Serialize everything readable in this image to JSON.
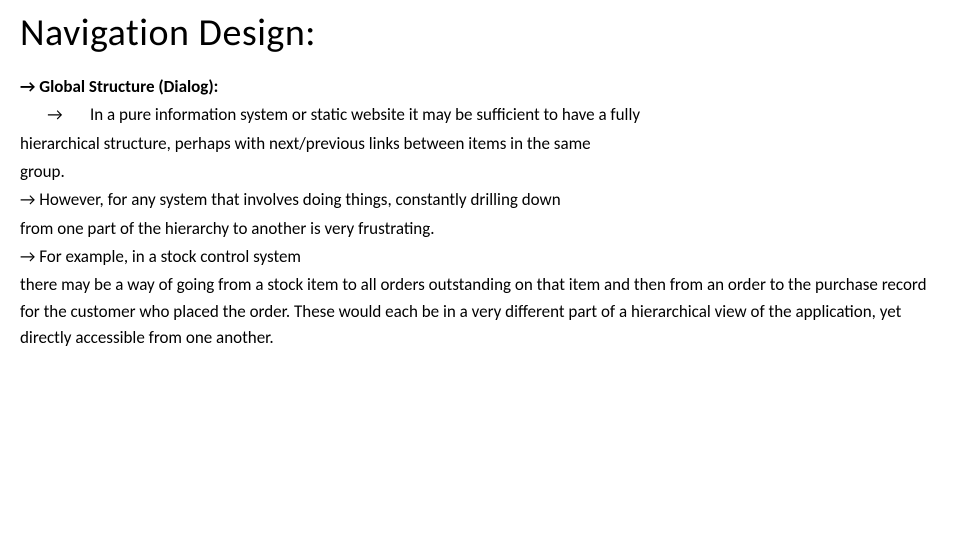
{
  "title": "Navigation Design:",
  "heading": "→ Global Structure (Dialog):",
  "arrow": "→",
  "p1a": "In a pure information system or static website it may be sufficient to have a fully",
  "p1b": "hierarchical structure, perhaps with next/previous links between items in the same",
  "p1c": "group.",
  "p2a": "→ However, for any system that involves doing things, constantly drilling down",
  "p2b": "from one part of the hierarchy to another is very frustrating.",
  "p3a": "→ For example, in a stock control system",
  "p3b": "there may be a way of going from a stock item to all orders outstanding on that item and then from an order to the purchase record for the customer who placed the order. These would each be in a very different part of a hierarchical view of the application, yet directly accessible from one another."
}
